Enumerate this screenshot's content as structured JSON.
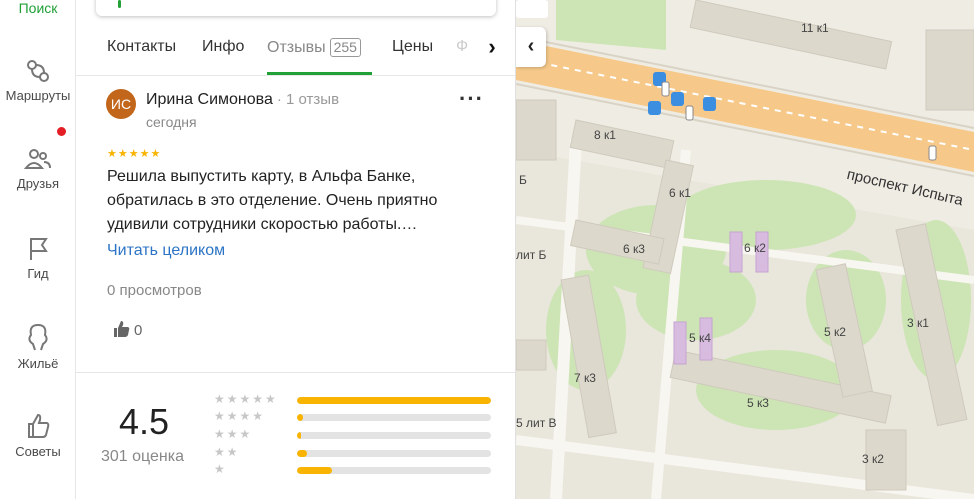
{
  "rail": {
    "search_label": "Поиск",
    "items": [
      {
        "label": "Маршруты",
        "icon": "routes-icon"
      },
      {
        "label": "Друзья",
        "icon": "friends-icon"
      },
      {
        "label": "Гид",
        "icon": "flag-icon"
      },
      {
        "label": "Жильё",
        "icon": "housing-icon"
      },
      {
        "label": "Советы",
        "icon": "thumb-up-icon"
      }
    ]
  },
  "tabs": {
    "contacts": "Контакты",
    "info": "Инфо",
    "reviews": "Отзывы",
    "reviews_count": "255",
    "prices": "Цены",
    "faded": "Ф"
  },
  "review": {
    "avatar_initials": "ИС",
    "author": "Ирина Симонова",
    "author_meta": "· 1 отзыв",
    "date": "сегодня",
    "stars": "★★★★★",
    "text": "Решила выпустить карту, в Альфа Банке, обратилась в это отделение. Очень приятно удивили сотрудники скоростью работы.…",
    "read_more": "Читать целиком",
    "views": "0 просмотров",
    "likes": "0"
  },
  "rating": {
    "value": "4.5",
    "count_text": "301 оценка",
    "distribution": [
      {
        "stars": "★★★★★",
        "fraction": 1.0
      },
      {
        "stars": "★★★★",
        "fraction": 0.03
      },
      {
        "stars": "★★★",
        "fraction": 0.02
      },
      {
        "stars": "★★",
        "fraction": 0.05
      },
      {
        "stars": "★",
        "fraction": 0.18
      }
    ]
  },
  "map": {
    "street": "проспект Испыта",
    "labels": [
      "11 к1",
      "8 к1",
      "6 к1",
      "6 к3",
      "6 к2",
      "лит Б",
      "5 к4",
      "5 к2",
      "3 к1",
      "7 к3",
      "5 к3",
      "5 лит В",
      "3 к2",
      "Б"
    ],
    "colors": {
      "road": "#f6c98a",
      "green": "#cde5b5",
      "building": "#dcd8cc",
      "accent": "#21a038"
    }
  }
}
